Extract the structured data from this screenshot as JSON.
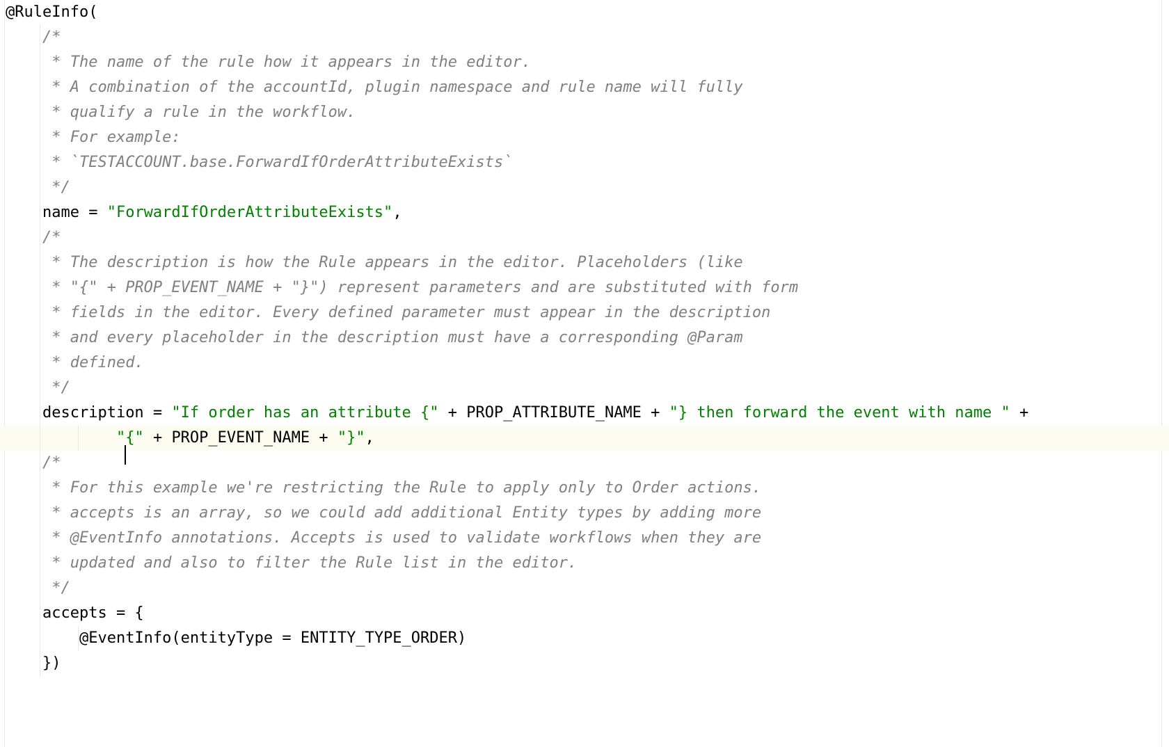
{
  "editor": {
    "language": "java",
    "background_color": "#ffffff",
    "current_line_highlight_color": "#fcfcf0",
    "colors": {
      "plain": "#000000",
      "comment": "#808080",
      "string": "#008000",
      "indent_guide": "#e8e8e8"
    },
    "caret": {
      "line_index": 17,
      "after_text": "\"",
      "visible": true
    }
  },
  "code": {
    "lines": [
      {
        "indent": 0,
        "segments": [
          {
            "type": "plain",
            "text": "@RuleInfo("
          }
        ]
      },
      {
        "indent": 2,
        "segments": [
          {
            "type": "comment",
            "text": "/*"
          }
        ]
      },
      {
        "indent": 2,
        "segments": [
          {
            "type": "comment",
            "text": " * The name of the rule how it appears in the editor."
          }
        ]
      },
      {
        "indent": 2,
        "segments": [
          {
            "type": "comment",
            "text": " * A combination of the accountId, plugin namespace and rule name will fully"
          }
        ]
      },
      {
        "indent": 2,
        "segments": [
          {
            "type": "comment",
            "text": " * qualify a rule in the workflow."
          }
        ]
      },
      {
        "indent": 2,
        "segments": [
          {
            "type": "comment",
            "text": " * For example:"
          }
        ]
      },
      {
        "indent": 2,
        "segments": [
          {
            "type": "comment",
            "text": " * `TESTACCOUNT.base.ForwardIfOrderAttributeExists`"
          }
        ]
      },
      {
        "indent": 2,
        "segments": [
          {
            "type": "comment",
            "text": " */"
          }
        ]
      },
      {
        "indent": 2,
        "segments": [
          {
            "type": "plain",
            "text": "name = "
          },
          {
            "type": "string",
            "text": "\"ForwardIfOrderAttributeExists\""
          },
          {
            "type": "plain",
            "text": ","
          }
        ]
      },
      {
        "indent": 2,
        "segments": [
          {
            "type": "comment",
            "text": "/*"
          }
        ]
      },
      {
        "indent": 2,
        "segments": [
          {
            "type": "comment",
            "text": " * The description is how the Rule appears in the editor. Placeholders (like"
          }
        ]
      },
      {
        "indent": 2,
        "segments": [
          {
            "type": "comment",
            "text": " * \"{\" + PROP_EVENT_NAME + \"}\") represent parameters and are substituted with form"
          }
        ]
      },
      {
        "indent": 2,
        "segments": [
          {
            "type": "comment",
            "text": " * fields in the editor. Every defined parameter must appear in the description"
          }
        ]
      },
      {
        "indent": 2,
        "segments": [
          {
            "type": "comment",
            "text": " * and every placeholder in the description must have a corresponding @Param"
          }
        ]
      },
      {
        "indent": 2,
        "segments": [
          {
            "type": "comment",
            "text": " * defined."
          }
        ]
      },
      {
        "indent": 2,
        "segments": [
          {
            "type": "comment",
            "text": " */"
          }
        ]
      },
      {
        "indent": 2,
        "segments": [
          {
            "type": "plain",
            "text": "description = "
          },
          {
            "type": "string",
            "text": "\"If order has an attribute {\""
          },
          {
            "type": "plain",
            "text": " + PROP_ATTRIBUTE_NAME + "
          },
          {
            "type": "string",
            "text": "\"} then forward the event with name \""
          },
          {
            "type": "plain",
            "text": " +"
          }
        ]
      },
      {
        "indent": 6,
        "current": true,
        "segments": [
          {
            "type": "string",
            "text": "\""
          },
          {
            "type": "caret",
            "text": ""
          },
          {
            "type": "string",
            "text": "{\""
          },
          {
            "type": "plain",
            "text": " + PROP_EVENT_NAME + "
          },
          {
            "type": "string",
            "text": "\"}\""
          },
          {
            "type": "plain",
            "text": ","
          }
        ]
      },
      {
        "indent": 2,
        "segments": [
          {
            "type": "comment",
            "text": "/*"
          }
        ]
      },
      {
        "indent": 2,
        "segments": [
          {
            "type": "comment",
            "text": " * For this example we're restricting the Rule to apply only to Order actions."
          }
        ]
      },
      {
        "indent": 2,
        "segments": [
          {
            "type": "comment",
            "text": " * accepts is an array, so we could add additional Entity types by adding more"
          }
        ]
      },
      {
        "indent": 2,
        "segments": [
          {
            "type": "comment",
            "text": " * @EventInfo annotations. Accepts is used to validate workflows when they are"
          }
        ]
      },
      {
        "indent": 2,
        "segments": [
          {
            "type": "comment",
            "text": " * updated and also to filter the Rule list in the editor."
          }
        ]
      },
      {
        "indent": 2,
        "segments": [
          {
            "type": "comment",
            "text": " */"
          }
        ]
      },
      {
        "indent": 2,
        "segments": [
          {
            "type": "plain",
            "text": "accepts = {"
          }
        ]
      },
      {
        "indent": 4,
        "segments": [
          {
            "type": "plain",
            "text": "@EventInfo(entityType = ENTITY_TYPE_ORDER)"
          }
        ]
      },
      {
        "indent": 2,
        "segments": [
          {
            "type": "plain",
            "text": "})"
          }
        ]
      }
    ]
  }
}
